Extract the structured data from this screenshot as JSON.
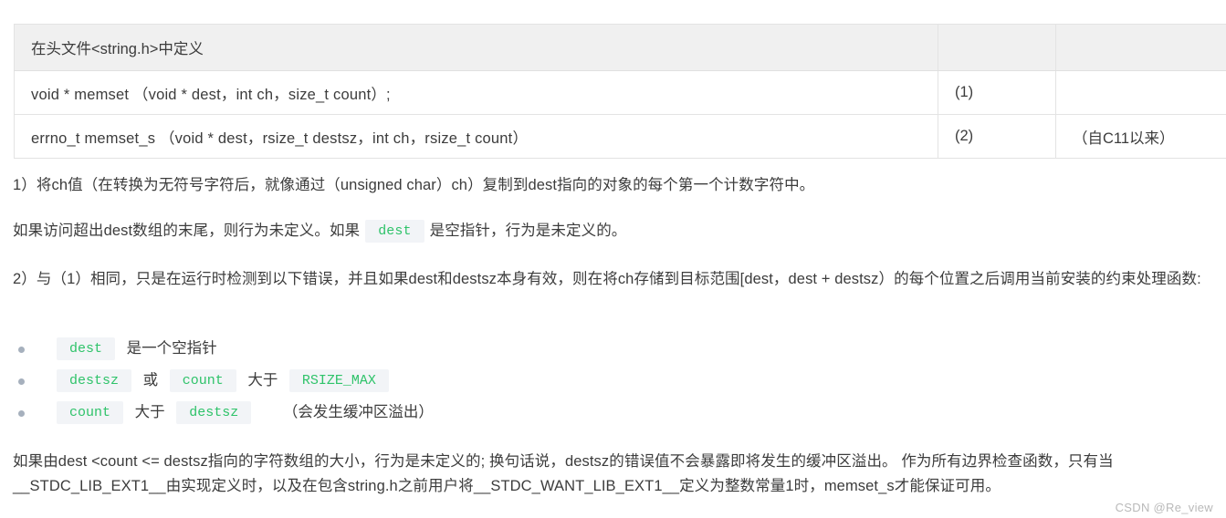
{
  "table": {
    "header": {
      "title": "在头文件<string.h>中定义",
      "num": "",
      "note": ""
    },
    "rows": [
      {
        "signature": "void * memset （void * dest，int ch，size_t count）;",
        "num": "(1)",
        "note": ""
      },
      {
        "signature": "errno_t memset_s （void * dest，rsize_t destsz，int ch，rsize_t count）",
        "num": "(2)",
        "note": "（自C11以来）"
      }
    ]
  },
  "paragraphs": {
    "p1": "1）将ch值（在转换为无符号字符后，就像通过（unsigned char）ch）复制到dest指向的对象的每个第一个计数字符中。",
    "p2_before": "如果访问超出dest数组的末尾，则行为未定义。如果",
    "p2_code": "dest",
    "p2_after": "是空指针，行为是未定义的。",
    "p3": "2）与（1）相同，只是在运行时检测到以下错误，并且如果dest和destsz本身有效，则在将ch存储到目标范围[dest，dest + destsz）的每个位置之后调用当前安装的约束处理函数:",
    "p4": "如果由dest <count <= destsz指向的字符数组的大小，行为是未定义的; 换句话说，destsz的错误值不会暴露即将发生的缓冲区溢出。 作为所有边界检查函数，只有当__STDC_LIB_EXT1__由实现定义时，以及在包含string.h之前用户将__STDC_WANT_LIB_EXT1__定义为整数常量1时，memset_s才能保证可用。"
  },
  "bullets": [
    {
      "code1": "dest",
      "mid": "是一个空指针",
      "code2": "",
      "mid2": "",
      "code3": "",
      "tail": ""
    },
    {
      "code1": "destsz",
      "mid": "或",
      "code2": "count",
      "mid2": "大于",
      "code3": "RSIZE_MAX",
      "tail": ""
    },
    {
      "code1": "count",
      "mid": "大于",
      "code2": "destsz",
      "mid2": "",
      "code3": "",
      "tail": "（会发生缓冲区溢出）"
    }
  ],
  "watermark": "CSDN @Re_view",
  "colors": {
    "code_text": "#2fc36a",
    "code_bg": "#f2f4f7",
    "table_header_bg": "#f0f0f0",
    "table_border": "#e3e3e3",
    "bullet": "#a6b0bd",
    "body_text": "#3c3c3c",
    "watermark": "#b9b9b9"
  }
}
